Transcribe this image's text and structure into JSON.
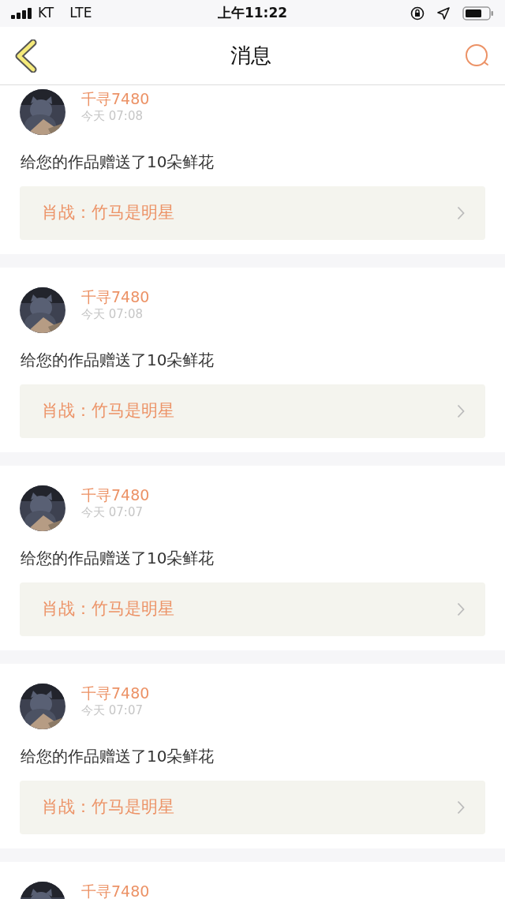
{
  "status_bar": {
    "carrier": "KT",
    "network": "LTE",
    "time": "上午11:22"
  },
  "nav": {
    "title": "消息"
  },
  "messages": [
    {
      "sender": "千寻7480",
      "time": "今天 07:08",
      "text": "给您的作品赠送了10朵鲜花",
      "work": "肖战：竹马是明星"
    },
    {
      "sender": "千寻7480",
      "time": "今天 07:08",
      "text": "给您的作品赠送了10朵鲜花",
      "work": "肖战：竹马是明星"
    },
    {
      "sender": "千寻7480",
      "time": "今天 07:07",
      "text": "给您的作品赠送了10朵鲜花",
      "work": "肖战：竹马是明星"
    },
    {
      "sender": "千寻7480",
      "time": "今天 07:07",
      "text": "给您的作品赠送了10朵鲜花",
      "work": "肖战：竹马是明星"
    },
    {
      "sender": "千寻7480"
    }
  ]
}
